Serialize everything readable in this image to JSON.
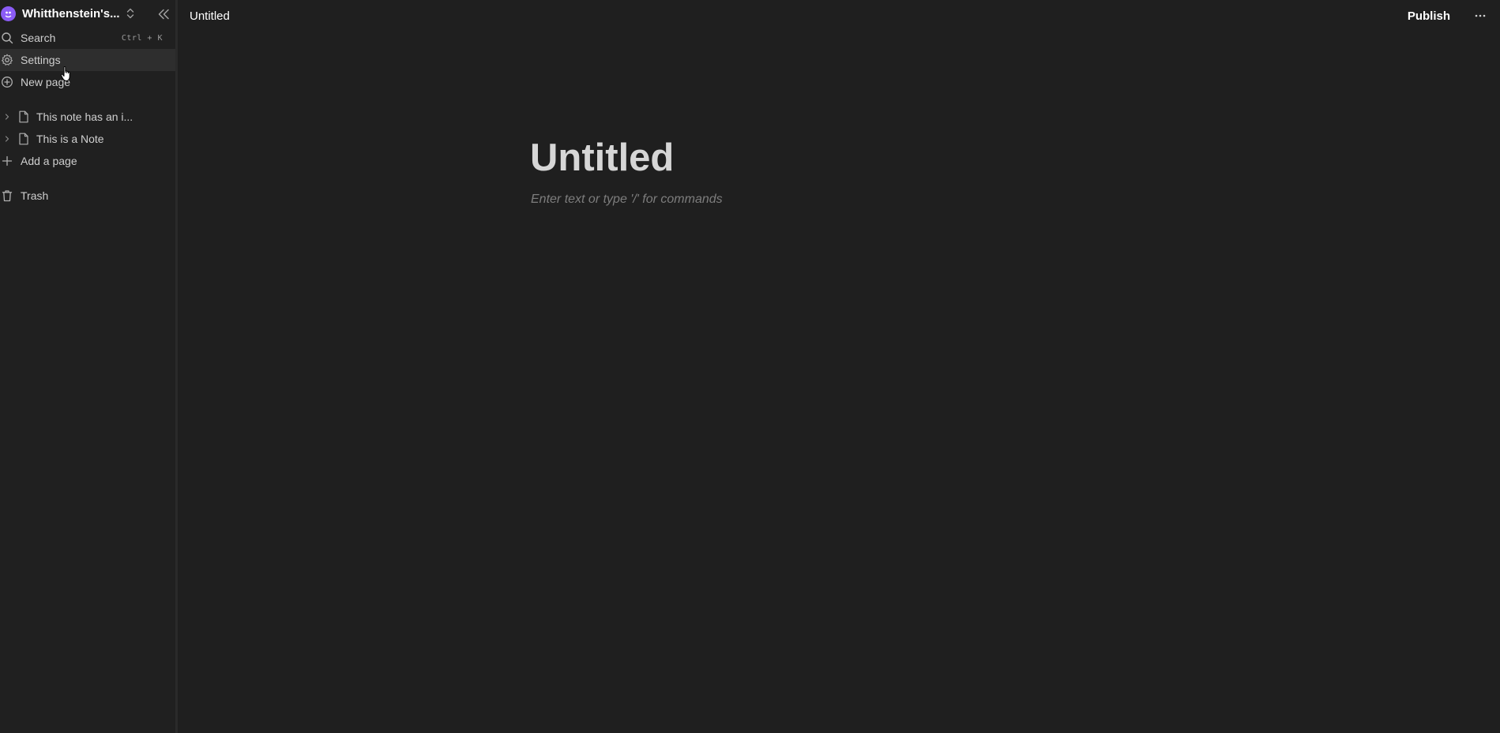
{
  "workspace": {
    "name": "Whitthenstein's...",
    "avatar_color": "#8b5cf6"
  },
  "sidebar": {
    "search_label": "Search",
    "search_shortcut": "Ctrl + K",
    "settings_label": "Settings",
    "new_page_label": "New page",
    "pages": [
      {
        "label": "This note has an i..."
      },
      {
        "label": "This is a Note"
      }
    ],
    "add_page_label": "Add a page",
    "trash_label": "Trash"
  },
  "topbar": {
    "breadcrumb": "Untitled",
    "publish_label": "Publish"
  },
  "editor": {
    "title": "Untitled",
    "placeholder": "Enter text or type '/' for commands"
  },
  "colors": {
    "background": "#1f1f1f",
    "sidebar_active": "#2e2e2e",
    "accent": "#8b5cf6"
  }
}
